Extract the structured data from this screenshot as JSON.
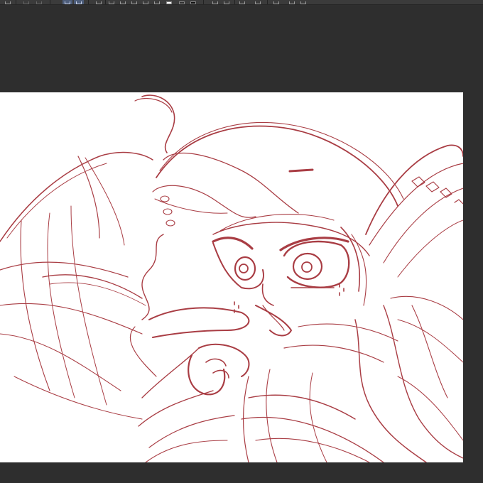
{
  "app": {
    "toolbar": {
      "buttons": [
        {
          "name": "toolbar-button-1",
          "icon": "window-icon"
        },
        {
          "name": "toolbar-button-2",
          "icon": "undo-icon"
        },
        {
          "name": "toolbar-button-3",
          "icon": "redo-icon"
        },
        {
          "name": "toolbar-button-4",
          "icon": "select-icon",
          "active": true
        },
        {
          "name": "toolbar-button-5",
          "icon": "lasso-icon",
          "active": true
        },
        {
          "name": "toolbar-button-6",
          "icon": "transform-icon"
        },
        {
          "name": "toolbar-button-7",
          "icon": "layer-icon"
        },
        {
          "name": "toolbar-button-8",
          "icon": "layer-new-icon"
        },
        {
          "name": "toolbar-button-9",
          "icon": "layer-copy-icon"
        },
        {
          "name": "toolbar-button-10",
          "icon": "rotate-left-icon"
        },
        {
          "name": "toolbar-button-11",
          "icon": "rotate-right-icon"
        },
        {
          "name": "toolbar-button-12",
          "icon": "flip-icon"
        },
        {
          "name": "toolbar-button-13",
          "icon": "grid-icon"
        },
        {
          "name": "toolbar-button-14",
          "icon": "ruler-icon"
        },
        {
          "name": "toolbar-button-15",
          "icon": "settings-icon"
        }
      ],
      "colors": {
        "main": "#ffffff",
        "sub": "#2f2f2f",
        "third": "#111111"
      }
    },
    "canvas": {
      "background": "#ffffff",
      "stroke_color": "#9b1c24"
    }
  }
}
